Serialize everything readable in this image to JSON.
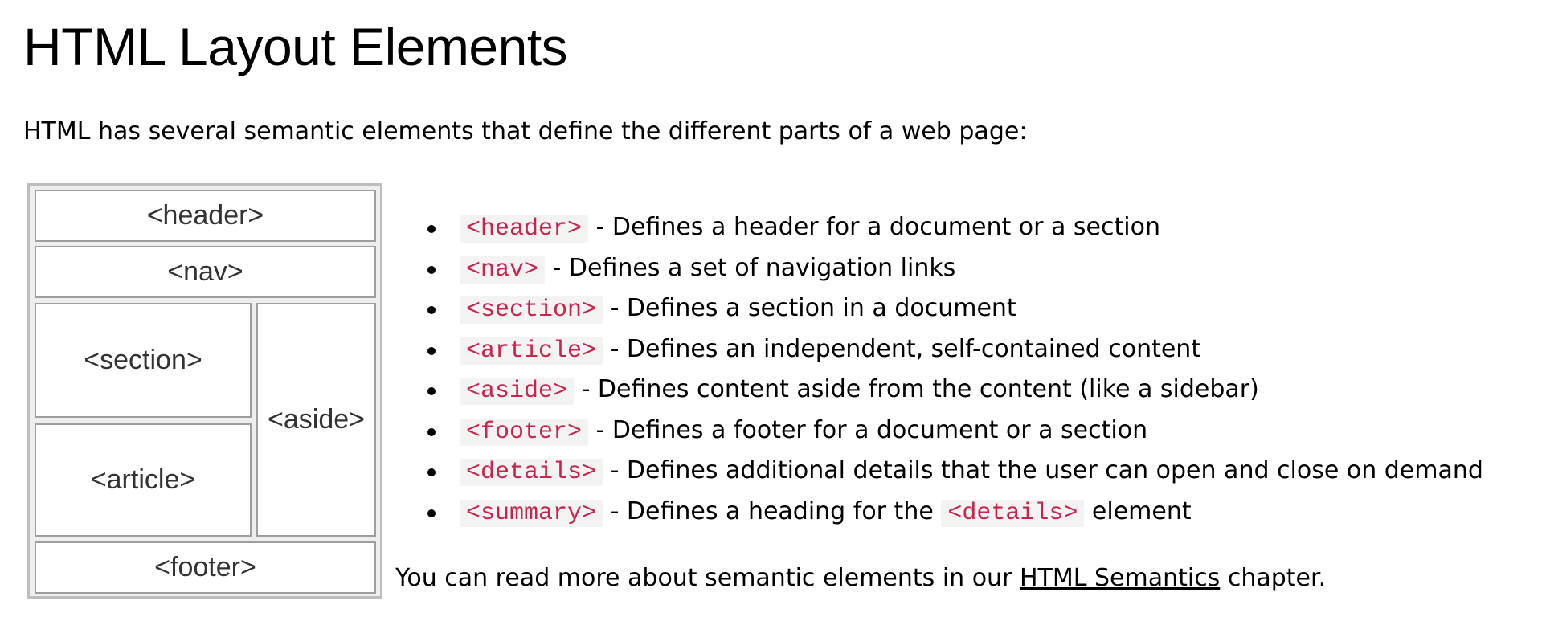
{
  "page": {
    "title": "HTML Layout Elements",
    "intro": "HTML has several semantic elements that define the different parts of a web page:"
  },
  "diagram": {
    "header": "<header>",
    "nav": "<nav>",
    "section": "<section>",
    "article": "<article>",
    "aside": "<aside>",
    "footer": "<footer>"
  },
  "elements": [
    {
      "tag": "<header>",
      "desc": " - Defines a header for a document or a section"
    },
    {
      "tag": "<nav>",
      "desc": " - Defines a set of navigation links"
    },
    {
      "tag": "<section>",
      "desc": " - Defines a section in a document"
    },
    {
      "tag": "<article>",
      "desc": " - Defines an independent, self-contained content"
    },
    {
      "tag": "<aside>",
      "desc": " - Defines content aside from the content (like a sidebar)"
    },
    {
      "tag": "<footer>",
      "desc": " - Defines a footer for a document or a section"
    },
    {
      "tag": "<details>",
      "desc": " - Defines additional details that the user can open and close on demand"
    },
    {
      "tag": "<summary>",
      "desc": " - Defines a heading for the ",
      "tag2": "<details>",
      "desc2": " element"
    }
  ],
  "footnote": {
    "before": "You can read more about semantic elements in our ",
    "link": "HTML Semantics",
    "after": " chapter."
  },
  "colors": {
    "code_text": "#c7254e",
    "code_bg": "#f3f3f3",
    "diagram_border": "#bdbdbd"
  }
}
